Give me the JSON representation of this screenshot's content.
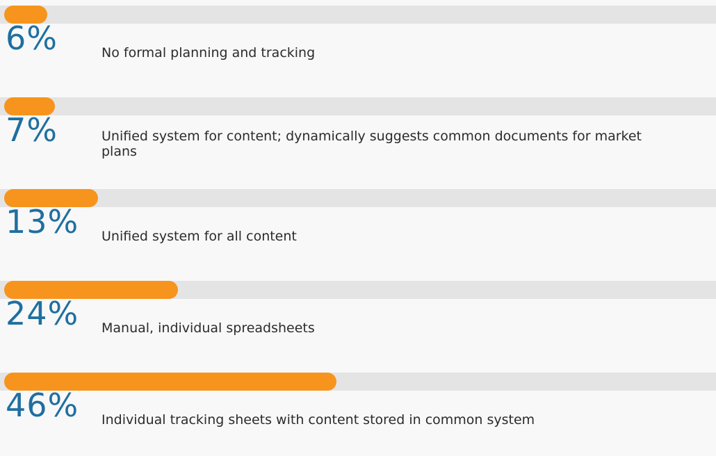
{
  "colors": {
    "bar": "#f7941d",
    "track": "#e4e4e4",
    "value_text": "#1f6fa0",
    "label_text": "#2b2b2b"
  },
  "chart_data": {
    "type": "bar",
    "orientation": "horizontal",
    "xlim": [
      0,
      100
    ],
    "rows": [
      {
        "value": 6,
        "value_label": "6%",
        "label": "No formal planning and tracking"
      },
      {
        "value": 7,
        "value_label": "7%",
        "label": "Unified system for content; dynamically suggests common documents for market plans"
      },
      {
        "value": 13,
        "value_label": "13%",
        "label": "Unified system for all content"
      },
      {
        "value": 24,
        "value_label": "24%",
        "label": "Manual, individual spreadsheets"
      },
      {
        "value": 46,
        "value_label": "46%",
        "label": "Individual tracking sheets with content stored in common system"
      }
    ]
  }
}
